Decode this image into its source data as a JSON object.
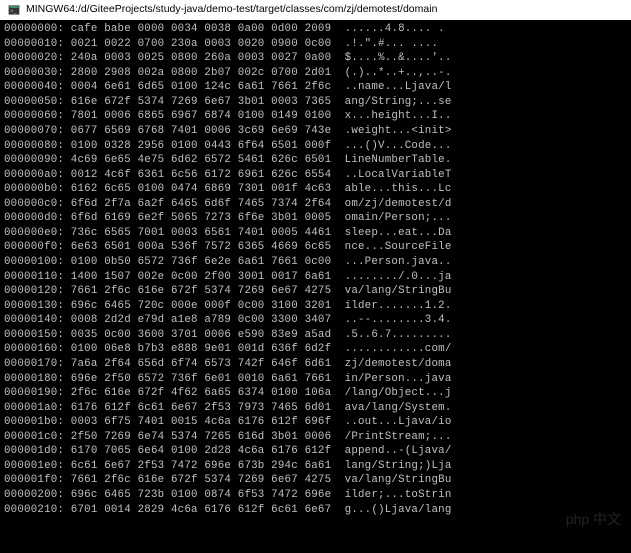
{
  "window": {
    "title": "MINGW64:/d/GiteeProjects/study-java/demo-test/target/classes/com/zj/demotest/domain"
  },
  "hex_lines": [
    {
      "off": "00000000:",
      "b": "cafe babe 0000 0034 0038 0a00 0d00 2009",
      "a": "......4.8.... ."
    },
    {
      "off": "00000010:",
      "b": "0021 0022 0700 230a 0003 0020 0900 0c00",
      "a": ".!.\".#... ...."
    },
    {
      "off": "00000020:",
      "b": "240a 0003 0025 0800 260a 0003 0027 0a00",
      "a": "$....%..&....'.."
    },
    {
      "off": "00000030:",
      "b": "2800 2908 002a 0800 2b07 002c 0700 2d01",
      "a": "(.)..*..+..,..-."
    },
    {
      "off": "00000040:",
      "b": "0004 6e61 6d65 0100 124c 6a61 7661 2f6c",
      "a": "..name...Ljava/l"
    },
    {
      "off": "00000050:",
      "b": "616e 672f 5374 7269 6e67 3b01 0003 7365",
      "a": "ang/String;...se"
    },
    {
      "off": "00000060:",
      "b": "7801 0006 6865 6967 6874 0100 0149 0100",
      "a": "x...height...I.."
    },
    {
      "off": "00000070:",
      "b": "0677 6569 6768 7401 0006 3c69 6e69 743e",
      "a": ".weight...<init>"
    },
    {
      "off": "00000080:",
      "b": "0100 0328 2956 0100 0443 6f64 6501 000f",
      "a": "...()V...Code..."
    },
    {
      "off": "00000090:",
      "b": "4c69 6e65 4e75 6d62 6572 5461 626c 6501",
      "a": "LineNumberTable."
    },
    {
      "off": "000000a0:",
      "b": "0012 4c6f 6361 6c56 6172 6961 626c 6554",
      "a": "..LocalVariableT"
    },
    {
      "off": "000000b0:",
      "b": "6162 6c65 0100 0474 6869 7301 001f 4c63",
      "a": "able...this...Lc"
    },
    {
      "off": "000000c0:",
      "b": "6f6d 2f7a 6a2f 6465 6d6f 7465 7374 2f64",
      "a": "om/zj/demotest/d"
    },
    {
      "off": "000000d0:",
      "b": "6f6d 6169 6e2f 5065 7273 6f6e 3b01 0005",
      "a": "omain/Person;..."
    },
    {
      "off": "000000e0:",
      "b": "736c 6565 7001 0003 6561 7401 0005 4461",
      "a": "sleep...eat...Da"
    },
    {
      "off": "000000f0:",
      "b": "6e63 6501 000a 536f 7572 6365 4669 6c65",
      "a": "nce...SourceFile"
    },
    {
      "off": "00000100:",
      "b": "0100 0b50 6572 736f 6e2e 6a61 7661 0c00",
      "a": "...Person.java.."
    },
    {
      "off": "00000110:",
      "b": "1400 1507 002e 0c00 2f00 3001 0017 6a61",
      "a": "......../.0...ja"
    },
    {
      "off": "00000120:",
      "b": "7661 2f6c 616e 672f 5374 7269 6e67 4275",
      "a": "va/lang/StringBu"
    },
    {
      "off": "00000130:",
      "b": "696c 6465 720c 000e 000f 0c00 3100 3201",
      "a": "ilder.......1.2."
    },
    {
      "off": "00000140:",
      "b": "0008 2d2d e79d a1e8 a789 0c00 3300 3407",
      "a": "..--........3.4."
    },
    {
      "off": "00000150:",
      "b": "0035 0c00 3600 3701 0006 e590 83e9 a5ad",
      "a": ".5..6.7........."
    },
    {
      "off": "00000160:",
      "b": "0100 06e8 b7b3 e888 9e01 001d 636f 6d2f",
      "a": "............com/"
    },
    {
      "off": "00000170:",
      "b": "7a6a 2f64 656d 6f74 6573 742f 646f 6d61",
      "a": "zj/demotest/doma"
    },
    {
      "off": "00000180:",
      "b": "696e 2f50 6572 736f 6e01 0010 6a61 7661",
      "a": "in/Person...java"
    },
    {
      "off": "00000190:",
      "b": "2f6c 616e 672f 4f62 6a65 6374 0100 106a",
      "a": "/lang/Object...j"
    },
    {
      "off": "000001a0:",
      "b": "6176 612f 6c61 6e67 2f53 7973 7465 6d01",
      "a": "ava/lang/System."
    },
    {
      "off": "000001b0:",
      "b": "0003 6f75 7401 0015 4c6a 6176 612f 696f",
      "a": "..out...Ljava/io"
    },
    {
      "off": "000001c0:",
      "b": "2f50 7269 6e74 5374 7265 616d 3b01 0006",
      "a": "/PrintStream;..."
    },
    {
      "off": "000001d0:",
      "b": "6170 7065 6e64 0100 2d28 4c6a 6176 612f",
      "a": "append..-(Ljava/"
    },
    {
      "off": "000001e0:",
      "b": "6c61 6e67 2f53 7472 696e 673b 294c 6a61",
      "a": "lang/String;)Lja"
    },
    {
      "off": "000001f0:",
      "b": "7661 2f6c 616e 672f 5374 7269 6e67 4275",
      "a": "va/lang/StringBu"
    },
    {
      "off": "00000200:",
      "b": "696c 6465 723b 0100 0874 6f53 7472 696e",
      "a": "ilder;...toStrin"
    },
    {
      "off": "00000210:",
      "b": "6701 0014 2829 4c6a 6176 612f 6c61 6e67",
      "a": "g...()Ljava/lang"
    }
  ],
  "watermark": "php 中文"
}
